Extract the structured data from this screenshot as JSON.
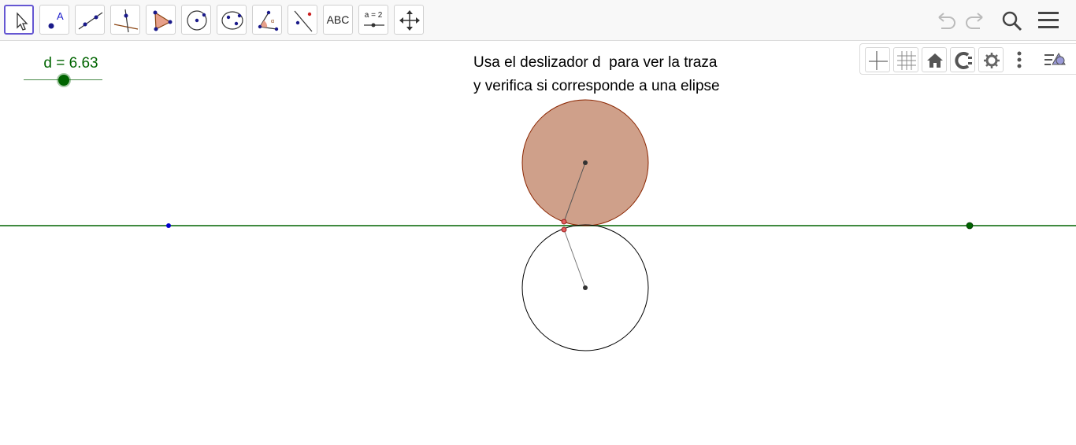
{
  "toolbar": {
    "tools": [
      {
        "name": "move-tool",
        "icon": "arrow-pointer-icon",
        "active": true
      },
      {
        "name": "point-tool",
        "icon": "point-icon"
      },
      {
        "name": "line-tool",
        "icon": "line-icon"
      },
      {
        "name": "perpendicular-line-tool",
        "icon": "perpendicular-icon"
      },
      {
        "name": "polygon-tool",
        "icon": "polygon-icon"
      },
      {
        "name": "circle-tool",
        "icon": "circle-center-point-icon"
      },
      {
        "name": "ellipse-tool",
        "icon": "ellipse-icon"
      },
      {
        "name": "angle-tool",
        "icon": "angle-icon"
      },
      {
        "name": "reflect-tool",
        "icon": "reflect-icon"
      },
      {
        "name": "text-tool",
        "label": "ABC"
      },
      {
        "name": "slider-tool",
        "label": "a = 2"
      },
      {
        "name": "move-graphics-tool",
        "icon": "move-arrows-icon"
      }
    ],
    "right_icons": [
      "undo-icon",
      "redo-icon",
      "search-icon",
      "menu-icon"
    ]
  },
  "style_bar": {
    "icons": [
      "axes-icon",
      "grid-icon",
      "home-icon",
      "point-capturing-icon",
      "settings-icon",
      "more-icon",
      "style-bar-toggle-icon"
    ]
  },
  "slider": {
    "label": "d = 6.63",
    "value": 6.63,
    "color": "#006400"
  },
  "text": {
    "line1": "Usa el deslizador d  para ver la traza",
    "line2": "y verifica si corresponde a una elipse"
  },
  "colors": {
    "line": "#006400",
    "circle_fill": "#cfa08a",
    "circle_stroke": "#8b2500",
    "blue_point": "#0000cc",
    "red_point": "#cc2222"
  }
}
